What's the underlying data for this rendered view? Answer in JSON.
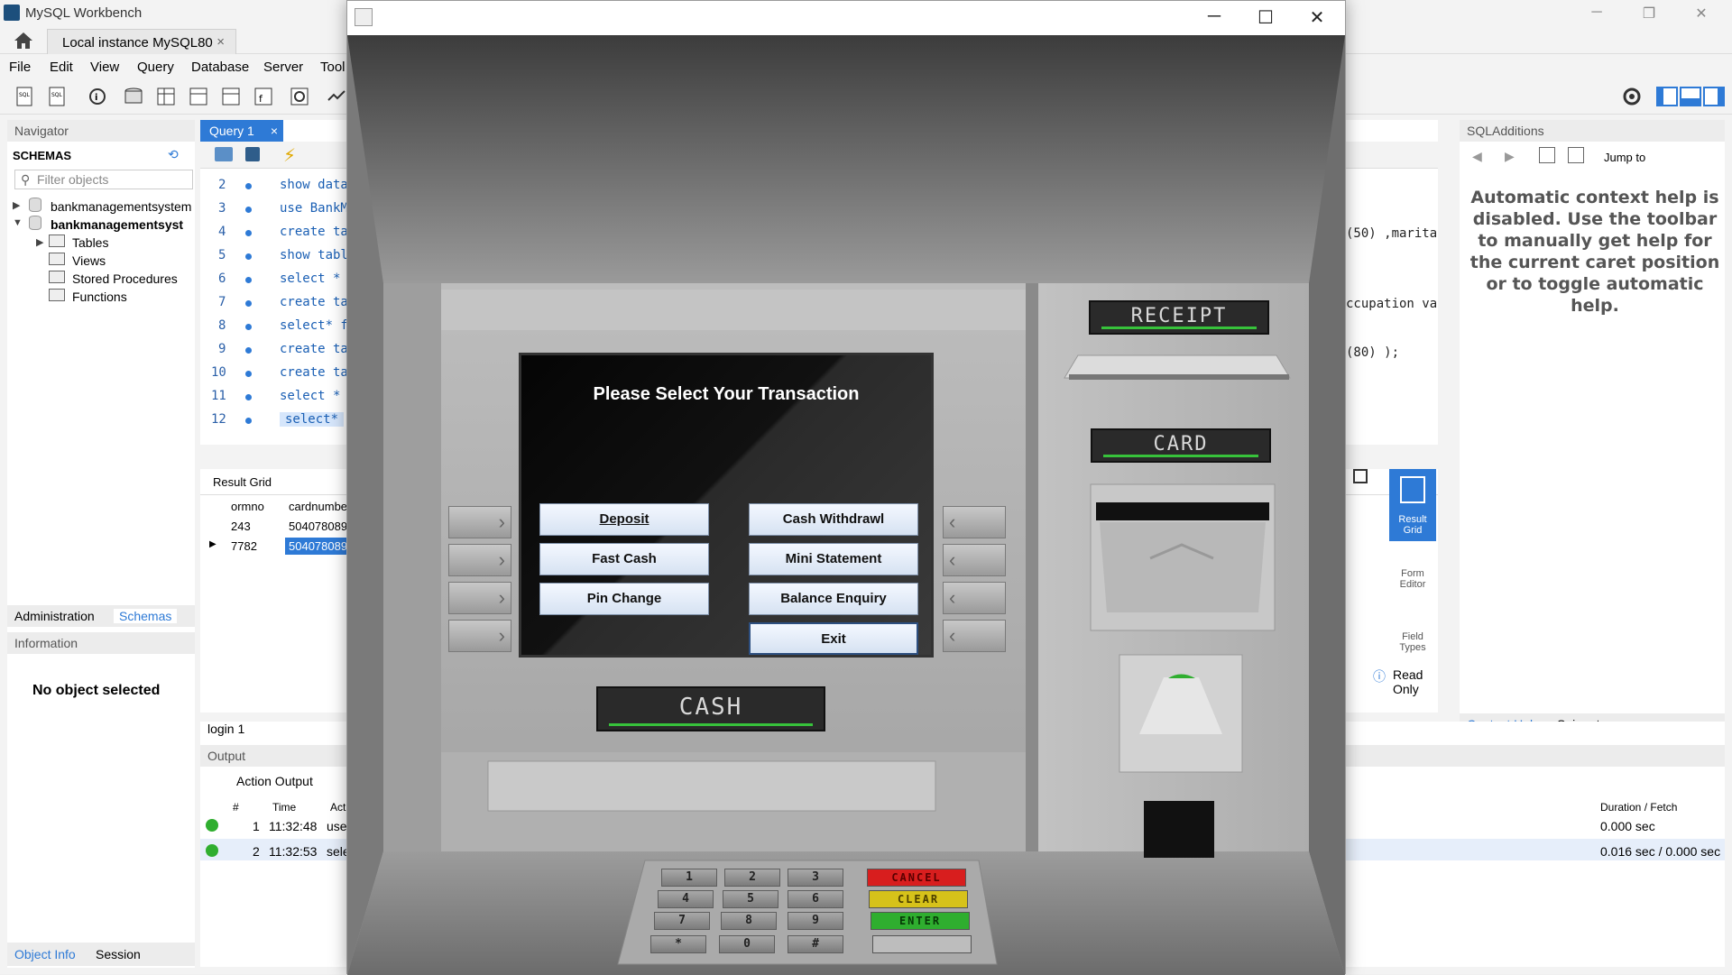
{
  "workbench": {
    "title": "MySQL Workbench",
    "connection_tab": "Local instance MySQL80",
    "menu": [
      "File",
      "Edit",
      "View",
      "Query",
      "Database",
      "Server",
      "Tool"
    ],
    "navigator": {
      "header": "Navigator",
      "schemas_label": "SCHEMAS",
      "filter_placeholder": "Filter objects",
      "tree": [
        "bankmanagementsystem",
        "bankmanagementsyst",
        "Tables",
        "Views",
        "Stored Procedures",
        "Functions"
      ],
      "tabs": [
        "Administration",
        "Schemas"
      ],
      "info_header": "Information",
      "no_object": "No object selected",
      "bottom_tabs": [
        "Object Info",
        "Session"
      ]
    },
    "editor": {
      "tab": "Query 1",
      "lines": [
        {
          "n": "2",
          "code": "show data"
        },
        {
          "n": "3",
          "code": "use BankM"
        },
        {
          "n": "4",
          "code": "create ta"
        },
        {
          "n": "5",
          "code": "show tabl"
        },
        {
          "n": "6",
          "code": "select *"
        },
        {
          "n": "7",
          "code": "create ta"
        },
        {
          "n": "8",
          "code": "select* f"
        },
        {
          "n": "9",
          "code": "create ta"
        },
        {
          "n": "10",
          "code": "create ta"
        },
        {
          "n": "11",
          "code": "select *"
        },
        {
          "n": "12",
          "code": "select*"
        }
      ],
      "right_snippets": [
        "(50) ,marita",
        "ccupation va",
        "(80) );"
      ]
    },
    "result": {
      "label": "Result Grid",
      "columns": [
        "ormno",
        "cardnumbe"
      ],
      "rows": [
        [
          "243",
          "504078089"
        ],
        [
          "7782",
          "504078089"
        ]
      ],
      "side_buttons": [
        "Result Grid",
        "Form Editor",
        "Field Types"
      ],
      "read_only": "Read Only"
    },
    "sql_additions": {
      "header": "SQLAdditions",
      "jump_to": "Jump to",
      "help_text": "Automatic context help is disabled. Use the toolbar to manually get help for the current caret position or to toggle automatic help.",
      "tabs": [
        "Context Help",
        "Snippets"
      ]
    },
    "login_tab": "login 1",
    "output": {
      "header": "Output",
      "mode": "Action Output",
      "columns": [
        "#",
        "Time",
        "Act",
        "Duration / Fetch"
      ],
      "rows": [
        {
          "n": "1",
          "time": "11:32:48",
          "action": "use",
          "duration": "0.000 sec"
        },
        {
          "n": "2",
          "time": "11:32:53",
          "action": "sele",
          "duration": "0.016 sec / 0.000 sec"
        }
      ]
    }
  },
  "atm": {
    "prompt": "Please Select Your Transaction",
    "buttons": {
      "deposit": "Deposit",
      "cash_withdrawl": "Cash Withdrawl",
      "fast_cash": "Fast Cash",
      "mini_statement": "Mini Statement",
      "pin_change": "Pin Change",
      "balance_enquiry": "Balance Enquiry",
      "exit": "Exit"
    },
    "labels": {
      "receipt": "RECEIPT",
      "card": "CARD",
      "cash": "CASH"
    },
    "keypad": [
      "1",
      "2",
      "3",
      "4",
      "5",
      "6",
      "7",
      "8",
      "9",
      "*",
      "0",
      "#"
    ],
    "function_keys": {
      "cancel": "CANCEL",
      "clear": "CLEAR",
      "enter": "ENTER"
    },
    "colors": {
      "cancel": "#d81e1e",
      "clear": "#d6c21a",
      "enter": "#2fae2f",
      "indicator": "#37c23b"
    }
  }
}
